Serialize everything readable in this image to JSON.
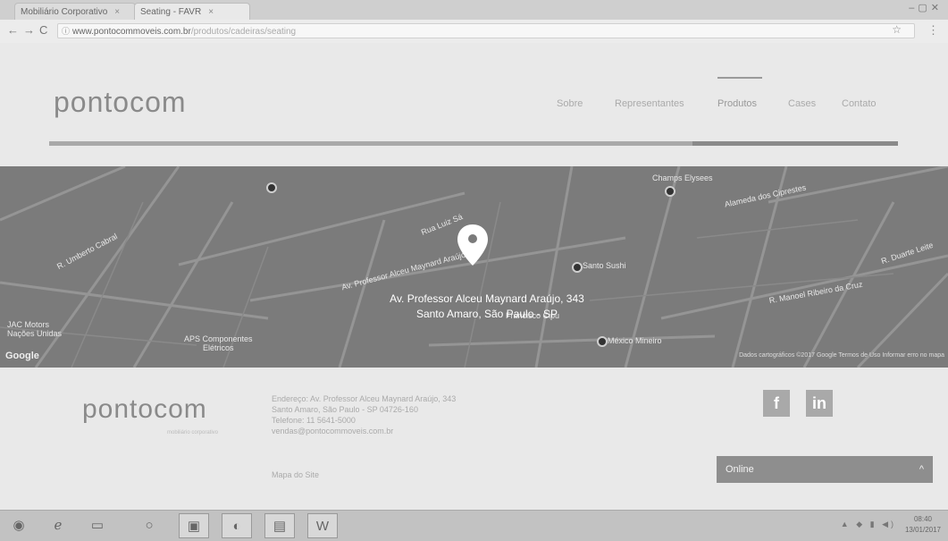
{
  "browser": {
    "tabs": [
      {
        "title": "Mobiliário Corporativo"
      },
      {
        "title": "Seating - FAVR"
      }
    ],
    "url_domain": "www.pontocommoveis.com.br",
    "url_path": "/produtos/cadeiras/seating"
  },
  "site": {
    "logo": "pontocom",
    "nav": [
      "Sobre",
      "Representantes",
      "Produtos",
      "Cases",
      "Contato"
    ],
    "active_nav": "Produtos"
  },
  "map": {
    "labels": {
      "champs": "Champs Elysees",
      "alameda_cipreste": "Alameda dos Ciprestes",
      "r_umberto": "R. Umberto Cabral",
      "santo_sushi": "Santo Sushi",
      "av_prof": "Av. Professor Alceu Maynard Araújo",
      "jac": "JAC Motors\nNações Unidas",
      "aps": "APS Componentes\nElétricos",
      "francisco": "Francisco Cipu",
      "mexico": "México Mineiro",
      "manoel": "R. Manoel Ribeiro da Cruz",
      "duarte": "R. Duarte Leite",
      "rua_luiz": "Rua Luiz Sá"
    },
    "address_line1": "Av. Professor Alceu Maynard Araújo, 343",
    "address_line2": "Santo Amaro, São Paulo - SP",
    "google": "Google",
    "footer": "Dados cartográficos ©2017 Google   Termos de Uso   Informar erro no mapa"
  },
  "footer": {
    "logo": "pontocom",
    "tagline": "mobiliário corporativo",
    "address": [
      "Endereço: Av. Professor Alceu Maynard Araújo, 343",
      "Santo Amaro, São Paulo - SP 04726-160",
      "Telefone: 11 5641-5000",
      "vendas@pontocommoveis.com.br"
    ],
    "sitemap": "Mapa do Site",
    "social": {
      "facebook": "f",
      "linkedin": "in"
    }
  },
  "chat": {
    "label": "Online"
  },
  "taskbar": {
    "clock_time": "08:40",
    "clock_date": "13/01/2017"
  },
  "colors": {
    "map_bg": "#7b7b7b",
    "chat_bg": "#8e8e8e",
    "social_bg": "#a9a9a9"
  }
}
